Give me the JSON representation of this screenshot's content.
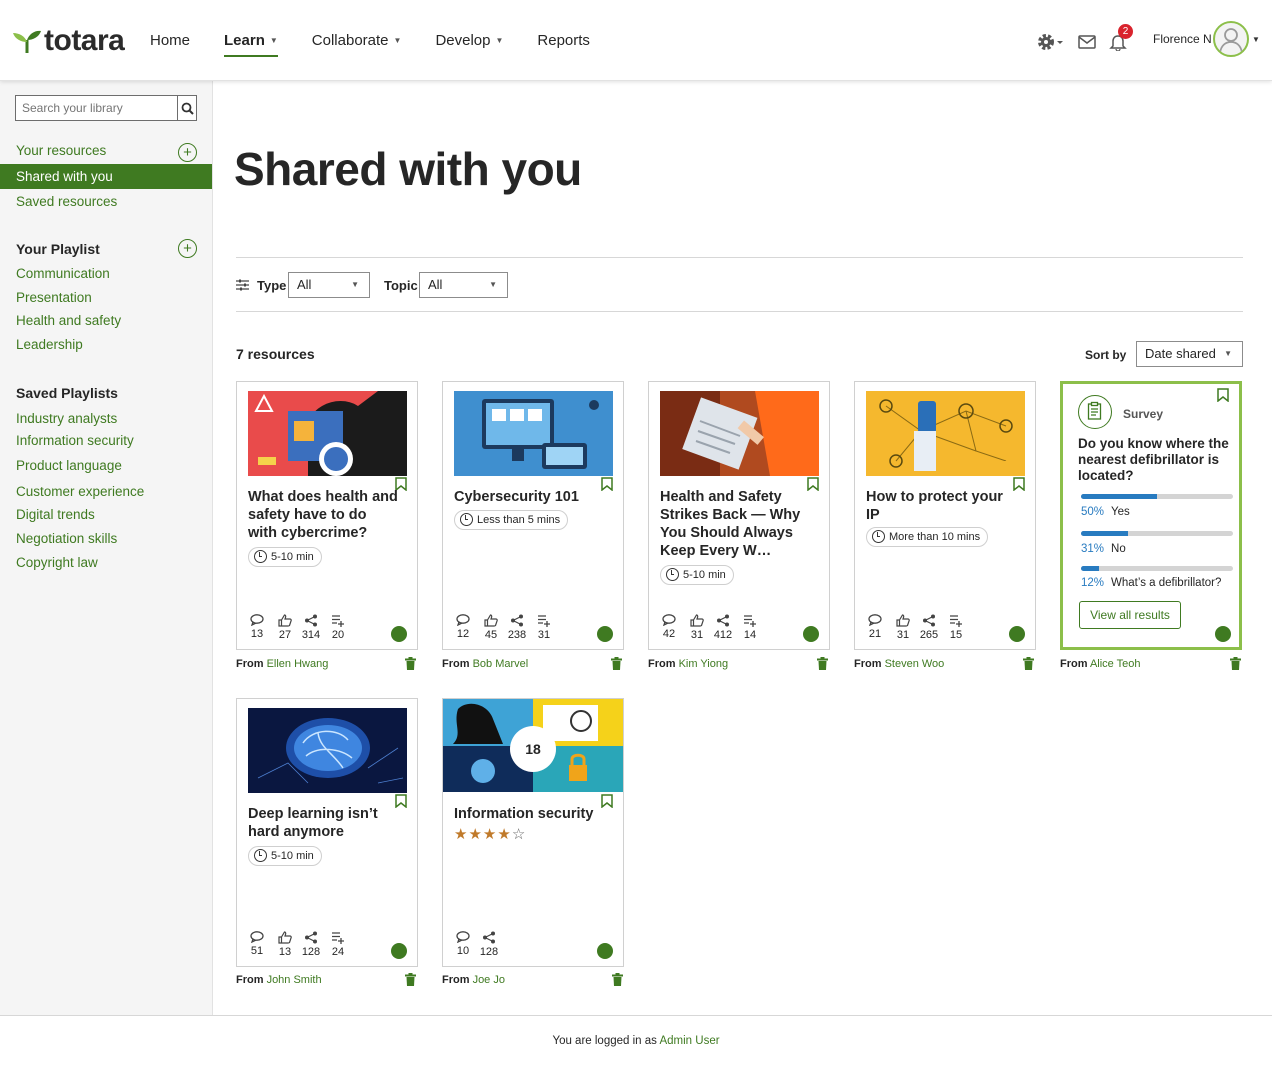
{
  "brand": {
    "name": "totara",
    "accent": "#3f7a21",
    "accent_light": "#8cbf4a"
  },
  "nav": [
    {
      "label": "Home",
      "caret": false,
      "active": false
    },
    {
      "label": "Learn",
      "caret": true,
      "active": true
    },
    {
      "label": "Collaborate",
      "caret": true,
      "active": false
    },
    {
      "label": "Develop",
      "caret": true,
      "active": false
    },
    {
      "label": "Reports",
      "caret": false,
      "active": false
    }
  ],
  "header": {
    "notification_count": "2",
    "user_name": "Florence N",
    "icons": [
      "gear-icon",
      "mail-icon",
      "bell-icon",
      "avatar-icon"
    ]
  },
  "sidebar": {
    "search_placeholder": "Search your library",
    "your_resources": "Your resources",
    "shared_with_you": "Shared with you",
    "saved_resources": "Saved resources",
    "your_playlist_heading": "Your Playlist",
    "your_playlists": [
      "Communication",
      "Presentation",
      "Health and safety",
      "Leadership"
    ],
    "saved_playlists_heading": "Saved Playlists",
    "saved_playlists": [
      "Industry analysts",
      "Information security",
      "Product language",
      "Customer experience",
      "Digital trends",
      "Negotiation skills",
      "Copyright law"
    ]
  },
  "main": {
    "title": "Shared with you",
    "filters": {
      "type_label": "Type",
      "type_value": "All",
      "topic_label": "Topic",
      "topic_value": "All"
    },
    "resource_count": "7 resources",
    "sort_label": "Sort by",
    "sort_value": "Date shared"
  },
  "cards": [
    {
      "title": "What does health and safety have to do with cybercrime?",
      "time": "5-10 min",
      "comments": "13",
      "likes": "27",
      "shares": "314",
      "playlists": "20",
      "from_label": "From",
      "from_user": "Ellen Hwang"
    },
    {
      "title": "Cybersecurity 101",
      "time": "Less than 5 mins",
      "comments": "12",
      "likes": "45",
      "shares": "238",
      "playlists": "31",
      "from_label": "From",
      "from_user": "Bob Marvel"
    },
    {
      "title": "Health and Safety Strikes Back — Why You Should Always Keep Every W…",
      "time": "5-10 min",
      "comments": "42",
      "likes": "31",
      "shares": "412",
      "playlists": "14",
      "from_label": "From",
      "from_user": "Kim Yiong"
    },
    {
      "title": "How to protect your IP",
      "time": "More than 10 mins",
      "comments": "21",
      "likes": "31",
      "shares": "265",
      "playlists": "15",
      "from_label": "From",
      "from_user": "Steven Woo"
    },
    {
      "title": "Deep learning isn’t hard anymore",
      "time": "5-10 min",
      "comments": "51",
      "likes": "13",
      "shares": "128",
      "playlists": "24",
      "from_label": "From",
      "from_user": "John Smith"
    }
  ],
  "survey": {
    "label": "Survey",
    "question": "Do you know where the nearest defibrillator is located?",
    "options": [
      {
        "pct": "50%",
        "label": "Yes",
        "fraction": 0.5
      },
      {
        "pct": "31%",
        "label": "No",
        "fraction": 0.31
      },
      {
        "pct": "12%",
        "label": "What’s a defibrillator?",
        "fraction": 0.12
      }
    ],
    "view_results": "View all results",
    "from_label": "From",
    "from_user": "Alice Teoh"
  },
  "playlist_card": {
    "title": "Information security",
    "count": "18",
    "rating": 4,
    "rating_max": 5,
    "comments": "10",
    "shares": "128",
    "from_label": "From",
    "from_user": "Joe Jo"
  },
  "footer": {
    "text": "You are logged in as",
    "user": "Admin User"
  }
}
